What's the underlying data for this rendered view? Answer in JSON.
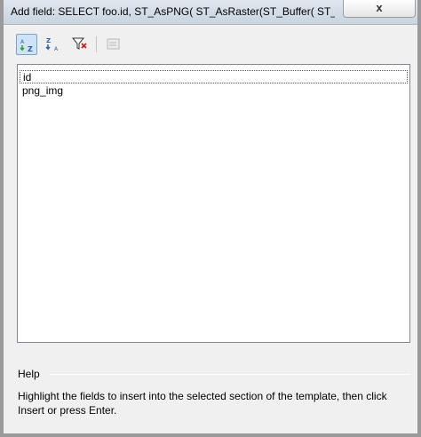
{
  "window": {
    "title": "Add field: SELECT foo.id, ST_AsPNG(   ST_AsRaster(ST_Buffer(     ST_MakeLi...",
    "close_icon": "close-icon",
    "close_label": "x"
  },
  "toolbar": {
    "buttons": [
      {
        "icon": "sort-ascending-icon",
        "pressed": true
      },
      {
        "icon": "sort-descending-icon",
        "pressed": false
      },
      {
        "icon": "filter-icon",
        "pressed": false
      },
      {
        "icon": "properties-icon",
        "pressed": false,
        "disabled": true
      }
    ]
  },
  "fields": {
    "items": [
      {
        "label": "id"
      },
      {
        "label": "png_img"
      }
    ]
  },
  "help": {
    "label": "Help",
    "text": "Highlight the fields to insert into the selected section of the template, then click Insert or press Enter."
  },
  "colors": {
    "title_bar": "#c9d4df",
    "pressed_button": "#cfe3f7",
    "list_border": "#828790"
  }
}
